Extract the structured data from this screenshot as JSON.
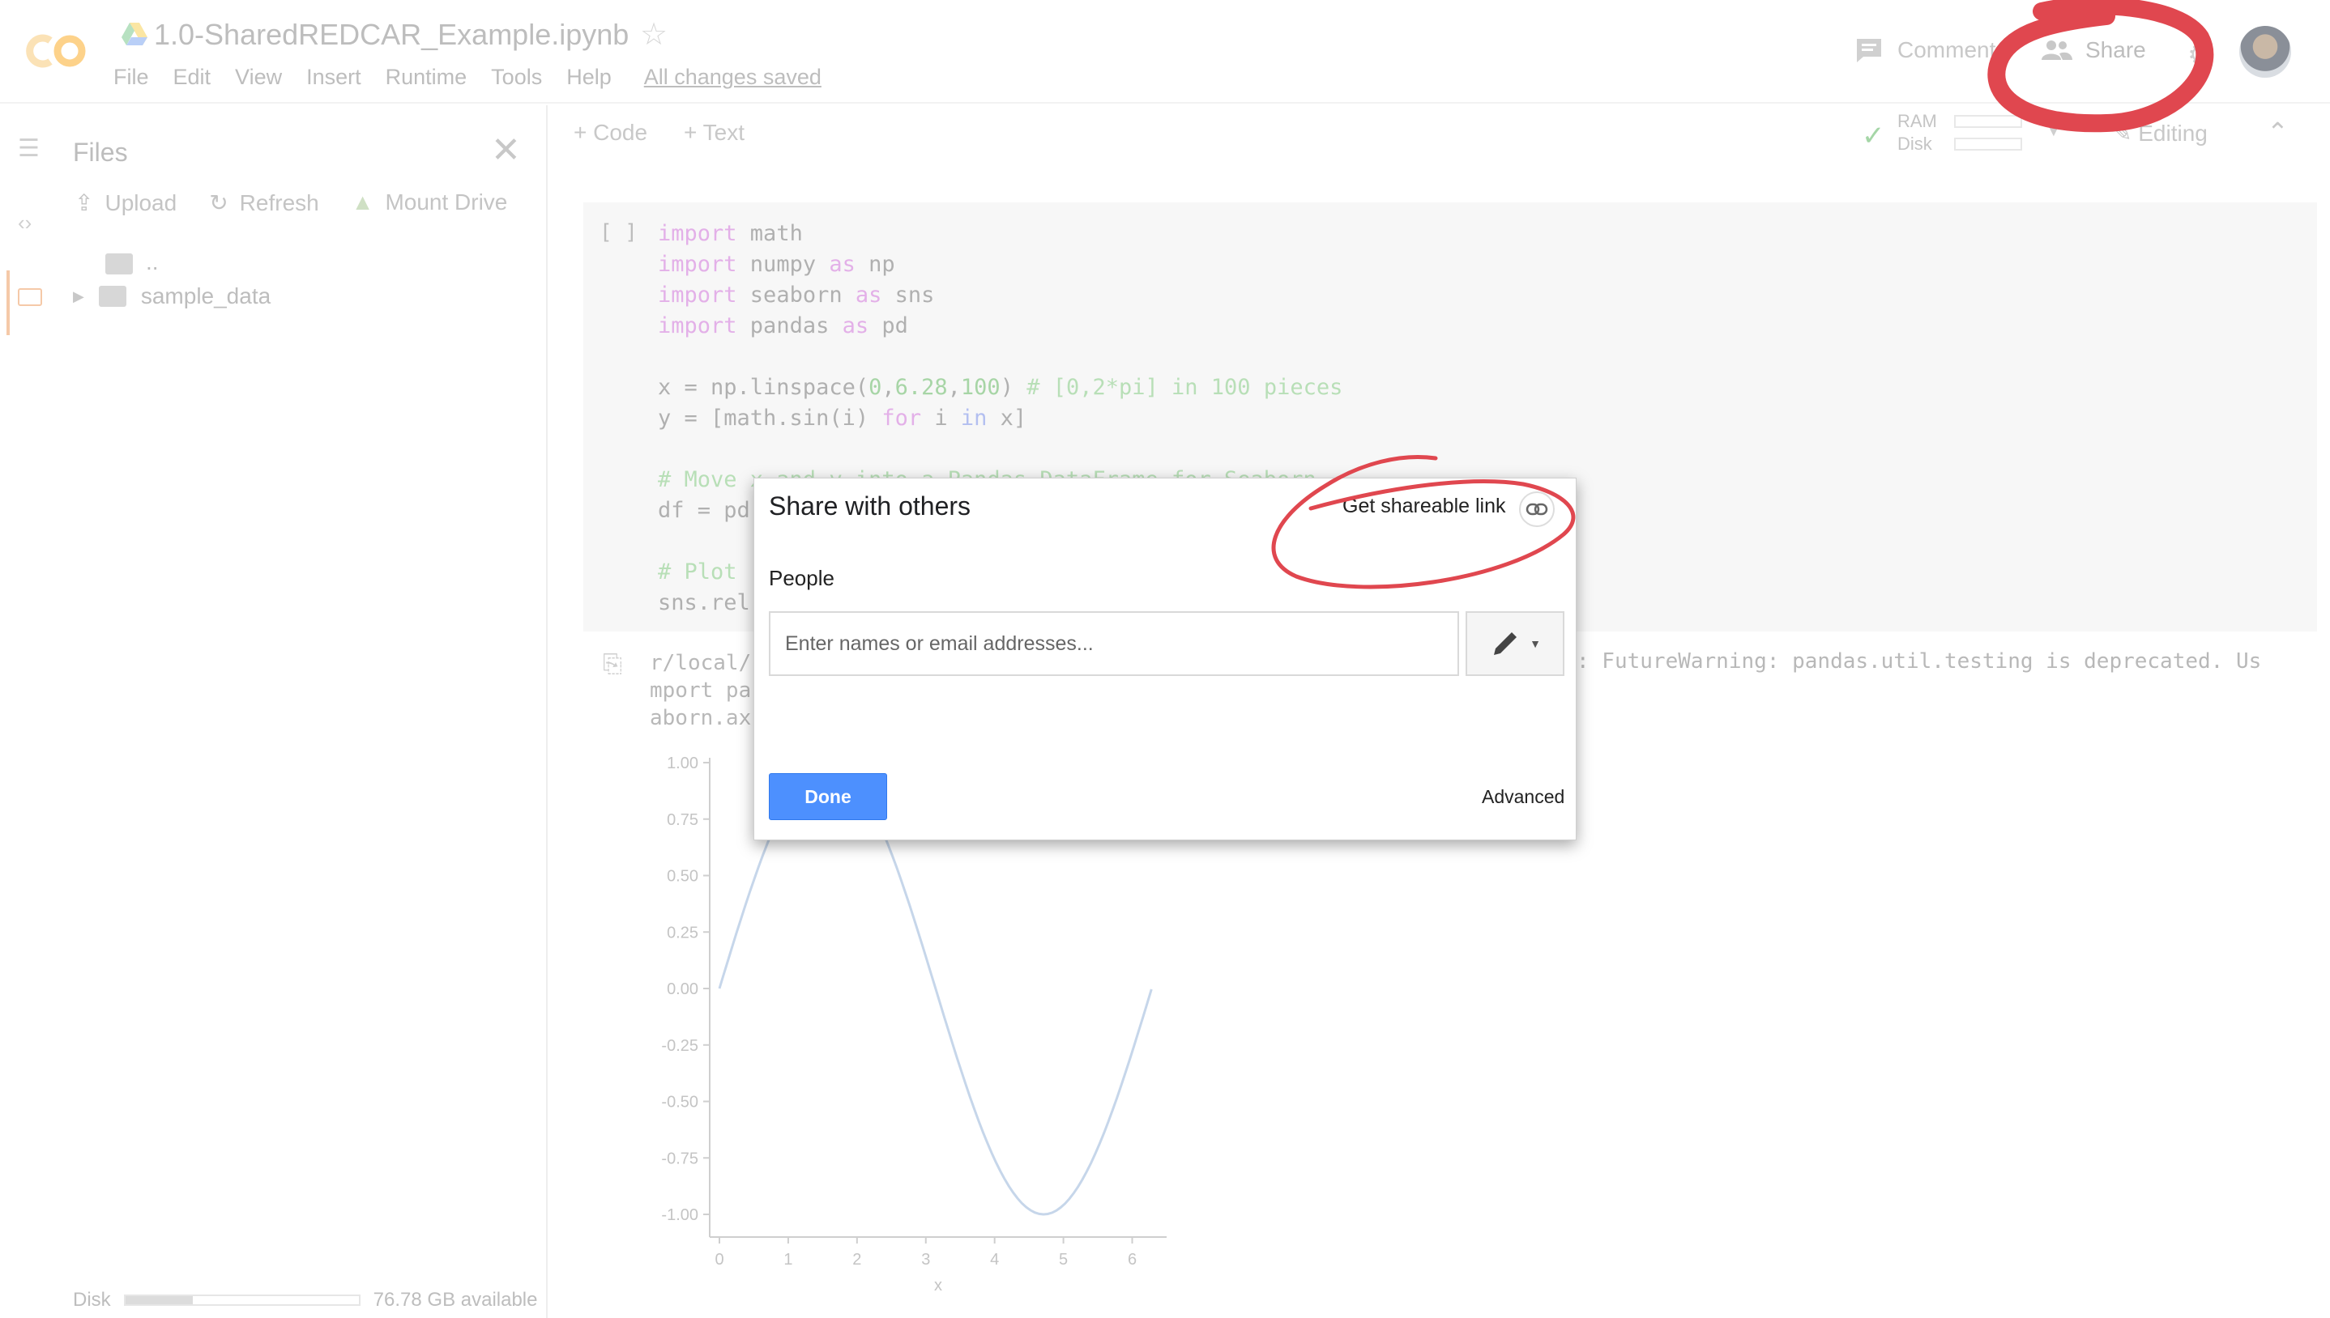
{
  "header": {
    "title": "1.0-SharedREDCAR_Example.ipynb",
    "menu": [
      "File",
      "Edit",
      "View",
      "Insert",
      "Runtime",
      "Tools",
      "Help"
    ],
    "save_status": "All changes saved",
    "comment_label": "Comment",
    "share_label": "Share"
  },
  "sidebar": {
    "title": "Files",
    "actions": {
      "upload": "Upload",
      "refresh": "Refresh",
      "mount": "Mount Drive"
    },
    "parent_dir": "..",
    "folders": [
      "sample_data"
    ],
    "disk_label": "Disk",
    "disk_available": "76.78 GB available",
    "disk_used_fraction": 0.29
  },
  "toolbar": {
    "add_code": "+ Code",
    "add_text": "+ Text",
    "ram_label": "RAM",
    "disk_label": "Disk",
    "editing_label": "Editing"
  },
  "cell": {
    "brackets": "[ ]",
    "code_lines": [
      "import math",
      "import numpy as np",
      "import seaborn as sns",
      "import pandas as pd",
      "",
      "x = np.linspace(0,6.28,100) # [0,2*pi] in 100 pieces",
      "y = [math.sin(i) for i in x]",
      "",
      "# Move x and y into a Pandas DataFrame for Seaborn",
      "df = pd",
      "",
      "# Plot",
      "sns.rel"
    ],
    "output_lines": [
      "r/local/",
      "mport pa",
      "aborn.ax"
    ],
    "output_warning": ": FutureWarning: pandas.util.testing is deprecated. Us"
  },
  "chart_data": {
    "type": "line",
    "xlabel": "x",
    "ylabel": "",
    "xlim": [
      0,
      6.5
    ],
    "ylim": [
      -1.0,
      1.0
    ],
    "x_ticks": [
      "0",
      "1",
      "2",
      "3",
      "4",
      "5",
      "6"
    ],
    "y_ticks": [
      "1.00",
      "0.75",
      "0.50",
      "0.25",
      "0.00",
      "-0.25",
      "-0.50",
      "-0.75",
      "-1.00"
    ],
    "series": [
      {
        "x": [
          0,
          0.5,
          1.0,
          1.5,
          2.0,
          2.5,
          3.0,
          3.5,
          4.0,
          4.5,
          5.0,
          5.5,
          6.0,
          6.28
        ],
        "values": [
          0,
          0.48,
          0.84,
          1.0,
          0.91,
          0.6,
          0.14,
          -0.35,
          -0.76,
          -0.98,
          -0.96,
          -0.71,
          -0.28,
          0
        ]
      }
    ],
    "color": "#c6d6ea"
  },
  "dialog": {
    "title": "Share with others",
    "link_label": "Get shareable link",
    "people_label": "People",
    "input_placeholder": "Enter names or email addresses...",
    "done_label": "Done",
    "advanced_label": "Advanced"
  },
  "colors": {
    "annotation": "#e0474f",
    "done_button": "#4d90fe",
    "logo": "#f9ab00"
  }
}
